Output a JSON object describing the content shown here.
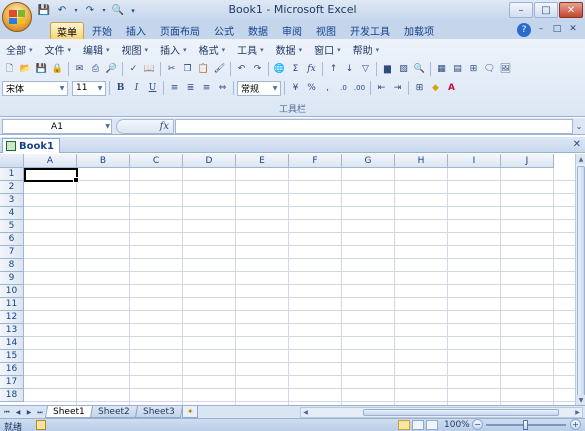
{
  "window": {
    "title": "Book1 - Microsoft Excel"
  },
  "tabs": [
    "菜单",
    "开始",
    "插入",
    "页面布局",
    "公式",
    "数据",
    "审阅",
    "视图",
    "开发工具",
    "加载项"
  ],
  "active_tab_index": 0,
  "menu": [
    {
      "label": "全部"
    },
    {
      "label": "文件"
    },
    {
      "label": "编辑"
    },
    {
      "label": "视图"
    },
    {
      "label": "插入"
    },
    {
      "label": "格式"
    },
    {
      "label": "工具"
    },
    {
      "label": "数据"
    },
    {
      "label": "窗口"
    },
    {
      "label": "帮助"
    }
  ],
  "toolbar": {
    "font_name": "宋体",
    "font_size": "11",
    "bold": "B",
    "italic": "I",
    "underline": "U",
    "number_format": "常规",
    "percent": "%",
    "comma": ",",
    "group_label": "工具栏"
  },
  "formula_bar": {
    "name_box": "A1",
    "fx": "fx",
    "formula": ""
  },
  "workbook": {
    "tab_label": "Book1"
  },
  "columns": [
    "A",
    "B",
    "C",
    "D",
    "E",
    "F",
    "G",
    "H",
    "I",
    "J"
  ],
  "rows": [
    "1",
    "2",
    "3",
    "4",
    "5",
    "6",
    "7",
    "8",
    "9",
    "10",
    "11",
    "12",
    "13",
    "14",
    "15",
    "16",
    "17",
    "18"
  ],
  "sheets": [
    "Sheet1",
    "Sheet2",
    "Sheet3"
  ],
  "active_sheet_index": 0,
  "status": {
    "ready": "就绪",
    "zoom": "100%"
  },
  "colors": {
    "accent": "#15428b",
    "ribbon_bg": "#dbe6f4",
    "active_tab": "#f7d67a",
    "gridline": "#d0d7e5"
  }
}
